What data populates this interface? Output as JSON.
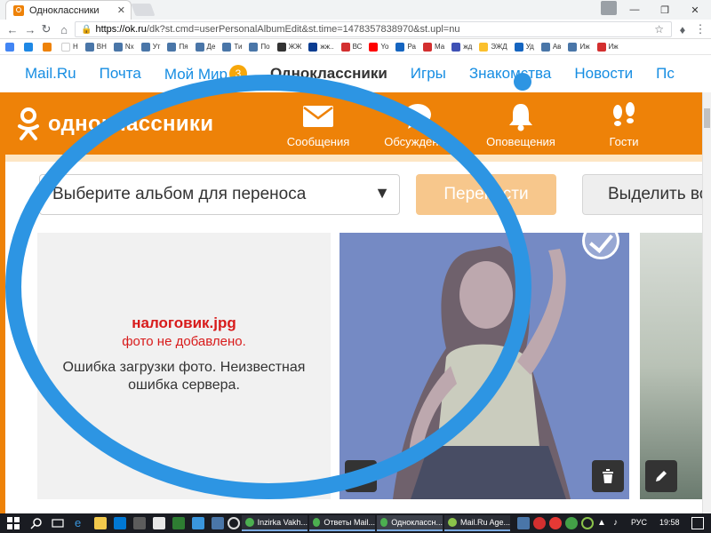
{
  "browser": {
    "tab_title": "Одноклассники",
    "tab_close": "✕",
    "url_host": "https://ok.ru",
    "url_path": "/dk?st.cmd=userPersonalAlbumEdit&st.time=1478357838970&st.upl=nu",
    "bookmarks": [
      {
        "label": "",
        "color": "#4285f4"
      },
      {
        "label": "",
        "color": "#1e88e5"
      },
      {
        "label": "",
        "color": "#ee8208"
      },
      {
        "label": "Н",
        "color": "#ffffff"
      },
      {
        "label": "ВН",
        "color": "#4a76a8"
      },
      {
        "label": "Nx",
        "color": "#4a76a8"
      },
      {
        "label": "Ут",
        "color": "#4a76a8"
      },
      {
        "label": "Пя",
        "color": "#4a76a8"
      },
      {
        "label": "Де",
        "color": "#4a76a8"
      },
      {
        "label": "Ти",
        "color": "#4a76a8"
      },
      {
        "label": "По",
        "color": "#4a76a8"
      },
      {
        "label": "ЖЖ",
        "color": "#333333"
      },
      {
        "label": "жж..",
        "color": "#0b3d91"
      },
      {
        "label": "ВС",
        "color": "#d32f2f"
      },
      {
        "label": "Yo",
        "color": "#ff0000"
      },
      {
        "label": "Ра",
        "color": "#1565c0"
      },
      {
        "label": "Ма",
        "color": "#d32f2f"
      },
      {
        "label": "жд",
        "color": "#3f51b5"
      },
      {
        "label": "ЭЖД",
        "color": "#fbc02d"
      },
      {
        "label": "Уд",
        "color": "#1565c0"
      },
      {
        "label": "Ав",
        "color": "#4a76a8"
      },
      {
        "label": "Иж",
        "color": "#4a76a8"
      },
      {
        "label": "Иж",
        "color": "#d32f2f"
      }
    ]
  },
  "portal_nav": {
    "items": [
      "Mail.Ru",
      "Почта",
      "Мой Мир",
      "Одноклассники",
      "Игры",
      "Знакомства",
      "Новости",
      "Пс"
    ],
    "badge": "3"
  },
  "ok_header": {
    "logo_text": "одноклассники",
    "items": [
      "Сообщения",
      "Обсуждения",
      "Оповещения",
      "Гости"
    ]
  },
  "toolbar": {
    "album_placeholder": "Выберите альбом для переноса",
    "move_label": "Перенести",
    "select_label": "Выделить все"
  },
  "upload_error": {
    "filename": "налоговик.jpg",
    "status": "фото не добавлено.",
    "message": "Ошибка загрузки фото. Неизвестная ошибка сервера."
  },
  "taskbar": {
    "apps": [
      "Inzirka Vakh...",
      "Ответы Mail...",
      "Одноклассн...",
      "Mail.Ru Age..."
    ],
    "lang": "РУС",
    "time": "19:58"
  },
  "colors": {
    "ok_orange": "#ee8208",
    "mailru_blue": "#168de2",
    "error_red": "#d81b1b",
    "annotation_blue": "#2d95e3"
  }
}
